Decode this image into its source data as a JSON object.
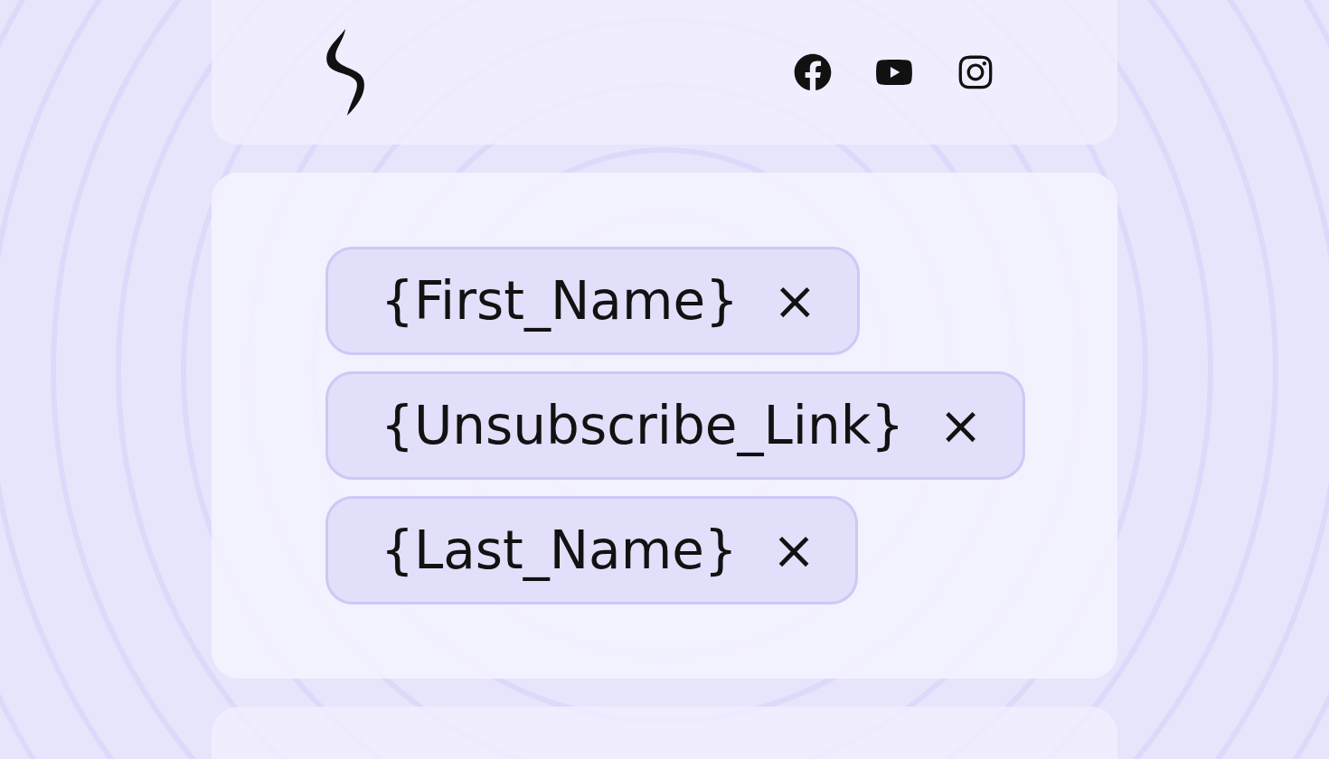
{
  "header": {
    "social_icons": [
      {
        "kind": "facebook"
      },
      {
        "kind": "youtube"
      },
      {
        "kind": "instagram"
      }
    ]
  },
  "tags": [
    {
      "label": "{First_Name}",
      "remove": "×"
    },
    {
      "label": "{Unsubscribe_Link}",
      "remove": "×"
    },
    {
      "label": "{Last_Name}",
      "remove": "×"
    }
  ]
}
